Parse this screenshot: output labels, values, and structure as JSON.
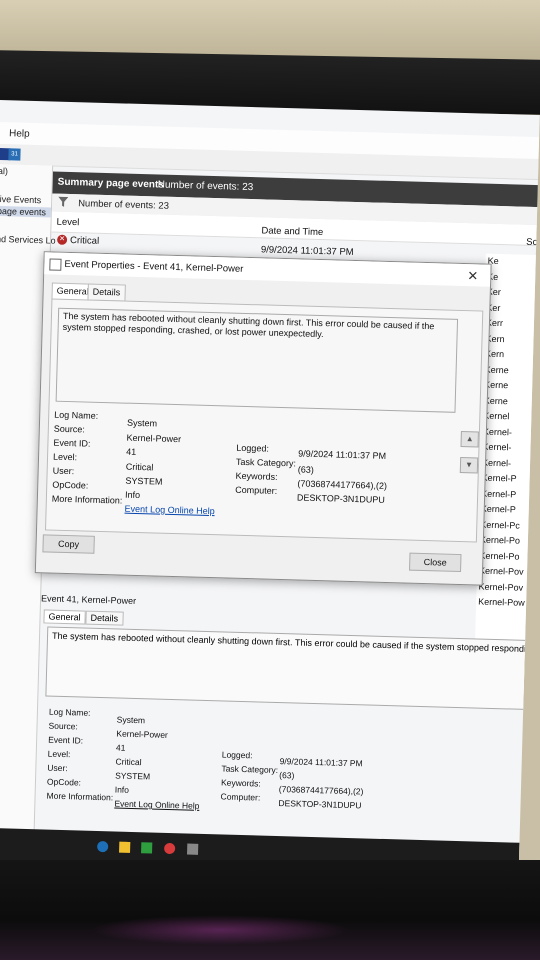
{
  "menu": {
    "help": "Help"
  },
  "toolbar": {
    "icon2": "31"
  },
  "left_pane": {
    "items": [
      "al)",
      "tive Events",
      "page events",
      "nd Services Lo"
    ]
  },
  "summary": {
    "title": "Summary page events",
    "count": "Number of events: 23",
    "filter_count": "Number of events: 23"
  },
  "grid": {
    "col_level": "Level",
    "col_datetime": "Date and Time",
    "col_source": "So",
    "first_level": "Critical",
    "first_datetime": "9/9/2024 11:01:37 PM"
  },
  "right_column": [
    "Ke",
    "Ke",
    "Ker",
    "Ker",
    "Kerr",
    "Kern",
    "Kern",
    "Kerne",
    "Kerne",
    "Kerne",
    "Kernel",
    "Kernel-",
    "Kernel-",
    "Kernel-",
    "Kernel-P",
    "Kernel-P",
    "Kernel-P",
    "Kernel-Pc",
    "Kernel-Po",
    "Kernel-Po",
    "Kernel-Pov",
    "Kernel-Pov",
    "Kernel-Pow"
  ],
  "dialog": {
    "title": "Event Properties - Event 41, Kernel-Power",
    "tab_general": "General",
    "tab_details": "Details",
    "description": "The system has rebooted without cleanly shutting down first. This error could be caused if the system stopped responding, crashed, or lost power unexpectedly.",
    "labels": {
      "log_name": "Log Name:",
      "source": "Source:",
      "event_id": "Event ID:",
      "level": "Level:",
      "user": "User:",
      "opcode": "OpCode:",
      "more_info": "More Information:",
      "logged": "Logged:",
      "task_category": "Task Category:",
      "keywords": "Keywords:",
      "computer": "Computer:"
    },
    "values": {
      "log_name": "System",
      "source": "Kernel-Power",
      "event_id": "41",
      "level": "Critical",
      "user": "SYSTEM",
      "opcode": "Info",
      "more_info": "Event Log Online Help",
      "logged": "9/9/2024 11:01:37 PM",
      "task_category": "(63)",
      "keywords": "(70368744177664),(2)",
      "computer": "DESKTOP-3N1DUPU"
    },
    "copy_button": "Copy",
    "close_button": "Close"
  },
  "preview": {
    "title": "Event 41, Kernel-Power",
    "tab_general": "General",
    "tab_details": "Details",
    "description": "The system has rebooted without cleanly shutting down first. This error could be caused if the system stopped responding, cras"
  }
}
